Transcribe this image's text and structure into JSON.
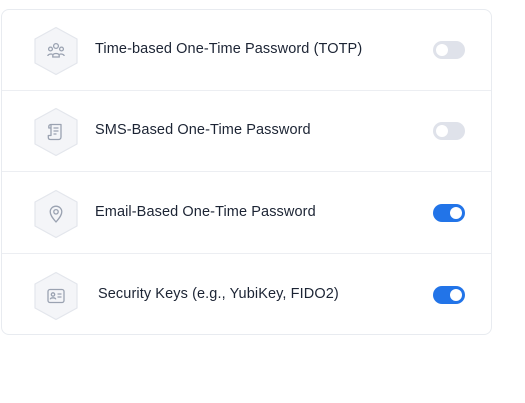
{
  "methods": [
    {
      "label": "Time-based One-Time Password (TOTP)",
      "icon": "people-group-icon",
      "enabled": false
    },
    {
      "label": "SMS-Based One-Time Password",
      "icon": "sms-scroll-icon",
      "enabled": false
    },
    {
      "label": "Email-Based One-Time Password",
      "icon": "location-pin-icon",
      "enabled": true
    },
    {
      "label": "Security Keys (e.g., YubiKey, FIDO2)",
      "icon": "id-card-icon",
      "enabled": true
    }
  ],
  "colors": {
    "toggle_on": "#2274e8",
    "toggle_off": "#dfe2ea",
    "text": "#1c2434",
    "icon_stroke": "#9aa2b1"
  }
}
